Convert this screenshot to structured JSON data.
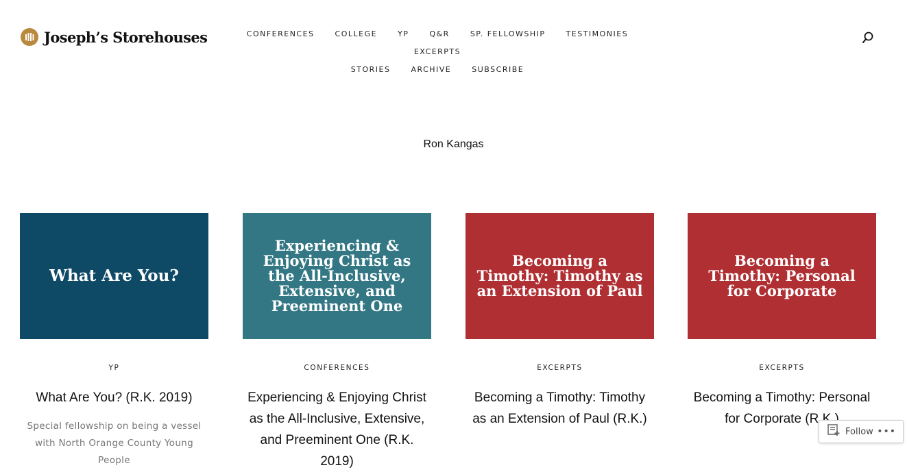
{
  "site": {
    "name": "Joseph’s Storehouses",
    "logo_color": "#b8893e"
  },
  "nav": {
    "row1": [
      "CONFERENCES",
      "COLLEGE",
      "YP",
      "Q&R",
      "SP. FELLOWSHIP",
      "TESTIMONIES",
      "EXCERPTS"
    ],
    "row2": [
      "STORIES",
      "ARCHIVE",
      "SUBSCRIBE"
    ]
  },
  "search_icon": "search-icon",
  "archive_title": "Ron Kangas",
  "posts": [
    {
      "image_text": "What Are You?",
      "image_bg": "#0e4a66",
      "category": "YP",
      "title": "What Are You? (R.K. 2019)",
      "excerpt": "Special fellowship on being a vessel with North Orange County Young People"
    },
    {
      "image_text": "Experiencing & Enjoying Christ as the All-Inclusive, Extensive, and Preeminent One",
      "image_bg": "#337784",
      "category": "CONFERENCES",
      "title": "Experiencing & Enjoying Christ as the All-Inclusive, Extensive, and Preeminent One (R.K. 2019)",
      "excerpt": ""
    },
    {
      "image_text": "Becoming a Timothy: Timothy as an Extension of Paul",
      "image_bg": "#b02f33",
      "category": "EXCERPTS",
      "title": "Becoming a Timothy: Timothy as an Extension of Paul (R.K.)",
      "excerpt": ""
    },
    {
      "image_text": "Becoming a Timothy: Personal for Corporate",
      "image_bg": "#b02f33",
      "category": "EXCERPTS",
      "title": "Becoming a Timothy: Personal for Corporate (R.K.)",
      "excerpt": ""
    }
  ],
  "follow": {
    "label": "Follow",
    "more": "•••"
  }
}
